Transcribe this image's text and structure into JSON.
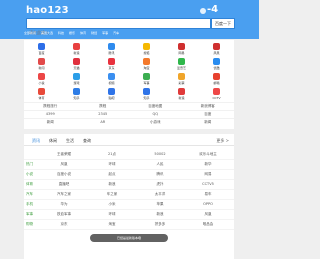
{
  "header": {
    "logo": "hao123",
    "weather_temp": "-4",
    "search_placeholder": "请在此输入",
    "search_button": "百度一下",
    "nav_links": [
      "全部新闻",
      "美国大选",
      "科技",
      "娱乐",
      "体育",
      "财经",
      "军事",
      "汽车"
    ]
  },
  "colors": {
    "brand": "#4a9ff0",
    "accent": "#2f83d8",
    "category": "#3a9b3a"
  },
  "icon_grid": [
    {
      "label": "百度",
      "icon": "baidu-icon",
      "color": "#2d6ee8"
    },
    {
      "label": "新浪",
      "icon": "sina-icon",
      "color": "#e84040"
    },
    {
      "label": "腾讯",
      "icon": "tencent-icon",
      "color": "#2e8bee"
    },
    {
      "label": "搜狐",
      "icon": "sohu-icon",
      "color": "#f5b800"
    },
    {
      "label": "网易",
      "icon": "netease-icon",
      "color": "#cf2f2f"
    },
    {
      "label": "凤凰",
      "icon": "ifeng-icon",
      "color": "#cf3030"
    },
    {
      "label": "新闻",
      "icon": "news-icon",
      "color": "#e24a4a"
    },
    {
      "label": "天猫",
      "icon": "tmall-icon",
      "color": "#e0303e"
    },
    {
      "label": "京东",
      "icon": "jd-icon",
      "color": "#e8323e"
    },
    {
      "label": "淘宝",
      "icon": "taobao-icon",
      "color": "#f4792b"
    },
    {
      "label": "爱奇艺",
      "icon": "iqiyi-icon",
      "color": "#2fb74b"
    },
    {
      "label": "优酷",
      "icon": "youku-icon",
      "color": "#2a8df0"
    },
    {
      "label": "小说",
      "icon": "novel-icon",
      "color": "#ec4646"
    },
    {
      "label": "游戏",
      "icon": "game-icon",
      "color": "#2b9ee8"
    },
    {
      "label": "视频",
      "icon": "video-icon",
      "color": "#3a8ff0"
    },
    {
      "label": "军事",
      "icon": "military-icon",
      "color": "#3cae51"
    },
    {
      "label": "彩票",
      "icon": "lottery-icon",
      "color": "#f0a52a"
    },
    {
      "label": "邮箱",
      "icon": "mail-icon",
      "color": "#e7412f"
    },
    {
      "label": "体育",
      "icon": "sports-icon",
      "color": "#e84a3a"
    },
    {
      "label": "知乎",
      "icon": "zhihu-icon",
      "color": "#2e7de6"
    },
    {
      "label": "贴吧",
      "icon": "tieba-icon",
      "color": "#2f74e8"
    },
    {
      "label": "知乎",
      "icon": "zhihu2-icon",
      "color": "#2f74e8"
    },
    {
      "label": "新浪",
      "icon": "weibo-icon",
      "color": "#e03a3a"
    },
    {
      "label": "CCTV",
      "icon": "cctv-icon",
      "color": "#ee4848"
    }
  ],
  "text_links": [
    [
      "携程旅行",
      "携程",
      "百度地图",
      "新浪博客"
    ],
    [
      "4399",
      "2345",
      "QQ",
      "百度"
    ],
    [
      "新闻",
      "AR",
      "小游戏",
      "新闻"
    ]
  ],
  "tabs": {
    "items": [
      "资讯",
      "休闲",
      "生活",
      "查询"
    ],
    "more": "更多 >"
  },
  "directory": [
    [
      "",
      "王者荣耀",
      "21点",
      "50002",
      "欢乐斗地主"
    ],
    [
      "热门",
      "凤凰",
      "环球",
      "人民",
      "新华"
    ],
    [
      "小说",
      "百度小说",
      "起点",
      "腾讯",
      "网易"
    ],
    [
      "体育",
      "直播吧",
      "新浪",
      "虎扑",
      "CCTV5"
    ],
    [
      "汽车",
      "汽车之家",
      "车之家",
      "太平洋",
      "易车"
    ],
    [
      "手机",
      "华为",
      "小米",
      "苹果",
      "OPPO"
    ],
    [
      "军事",
      "铁血军事",
      "环球",
      "新浪",
      "凤凰"
    ],
    [
      "购物",
      "京东",
      "淘宝",
      "拼多多",
      "唯品会"
    ]
  ],
  "toast": "已经是最新版本哦"
}
